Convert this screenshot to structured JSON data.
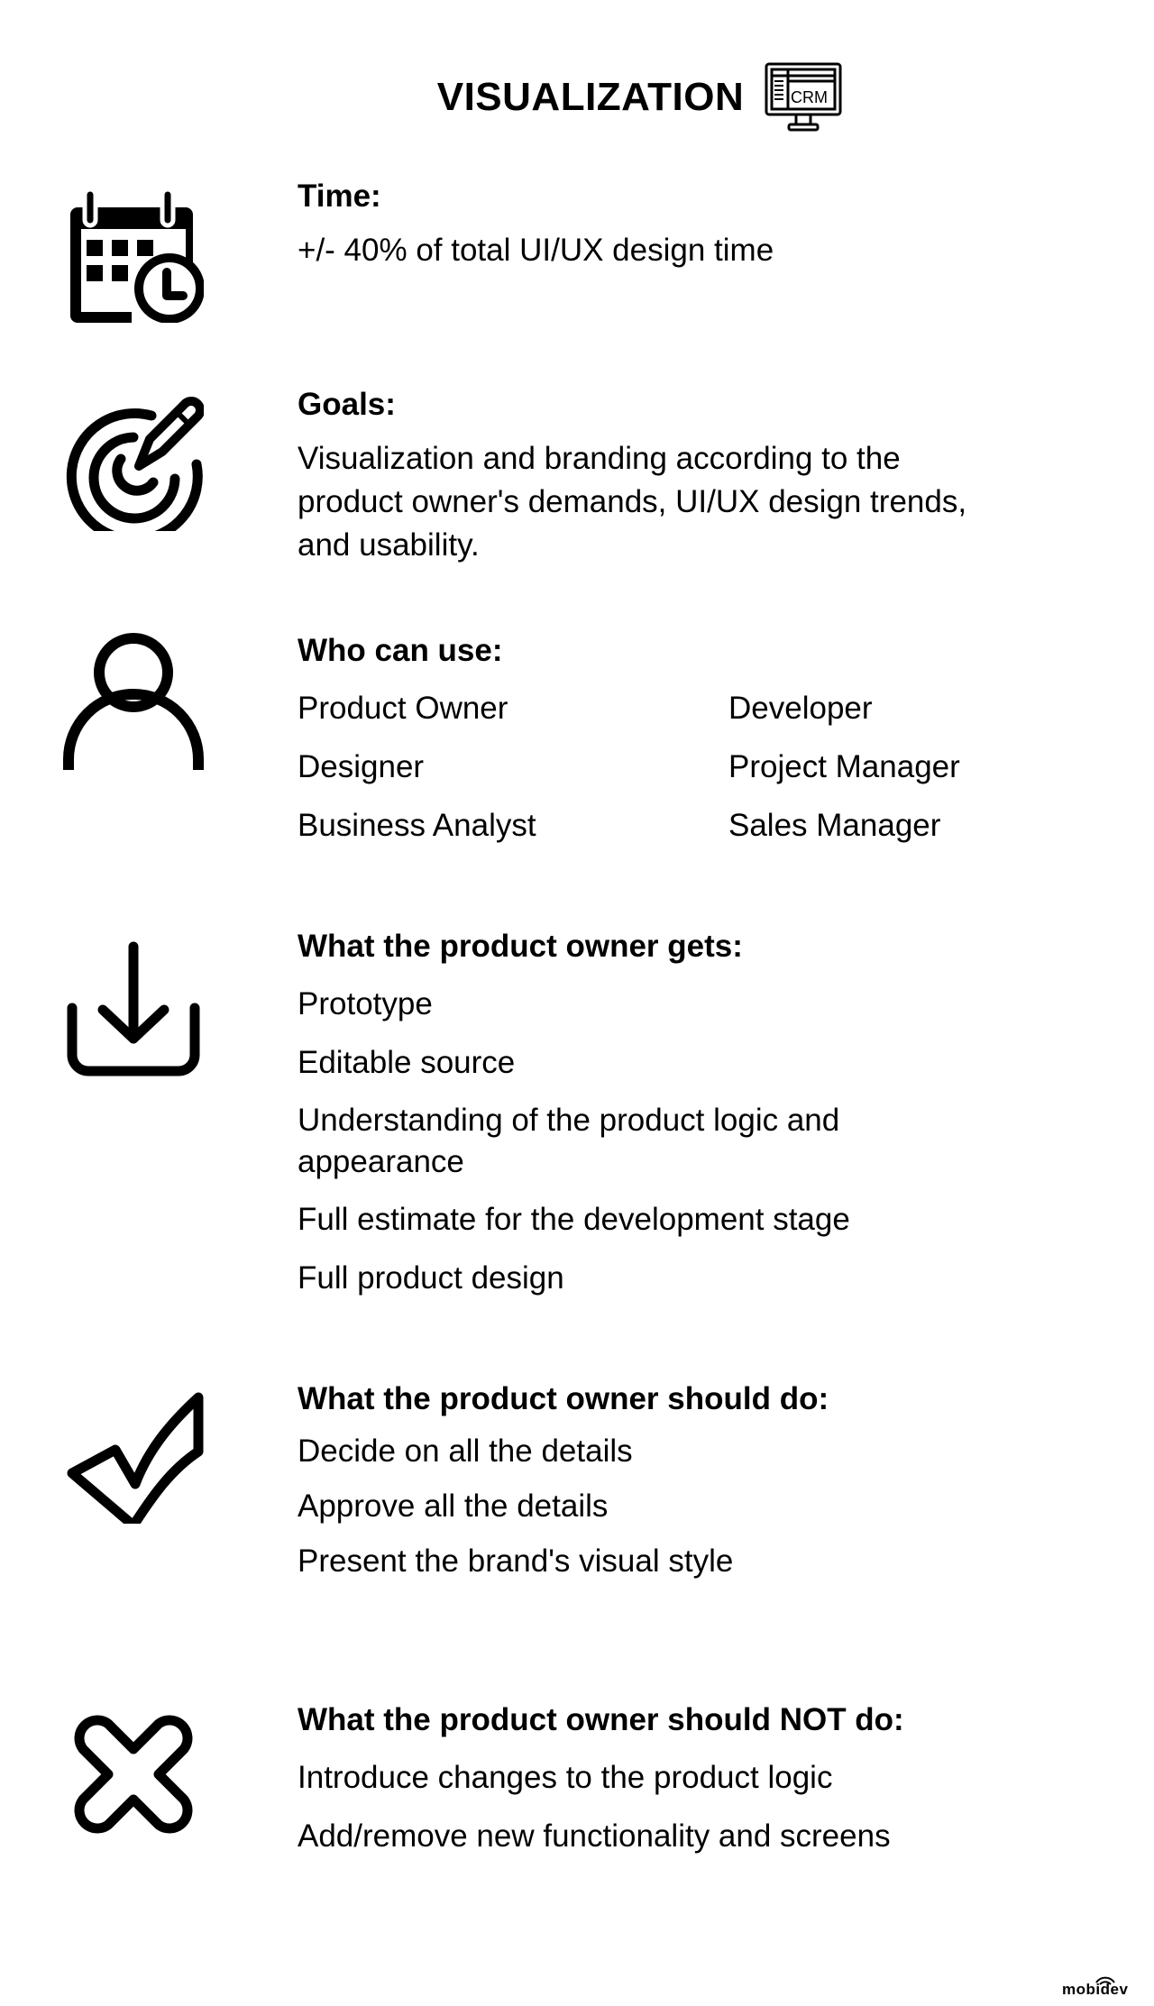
{
  "header": {
    "title": "VISUALIZATION",
    "icon": "crm-monitor-icon",
    "icon_label": "CRM"
  },
  "sections": {
    "time": {
      "icon": "calendar-clock-icon",
      "heading": "Time:",
      "text": "+/- 40% of total UI/UX design time"
    },
    "goals": {
      "icon": "target-pencil-icon",
      "heading": "Goals:",
      "text": "Visualization and branding according to the product owner's demands, UI/UX design trends, and usability."
    },
    "who_can_use": {
      "icon": "user-icon",
      "heading": "Who can use:",
      "items": [
        "Product Owner",
        "Developer",
        "Designer",
        "Project Manager",
        "Business Analyst",
        "Sales Manager"
      ]
    },
    "gets": {
      "icon": "download-icon",
      "heading": "What the product owner gets:",
      "items": [
        "Prototype",
        "Editable source",
        "Understanding of the product logic and appearance",
        "Full estimate for the development stage",
        "Full product design"
      ]
    },
    "should_do": {
      "icon": "checkmark-icon",
      "heading": "What the product owner should do:",
      "items": [
        "Decide on all the details",
        "Approve all the details",
        "Present the brand's visual style"
      ]
    },
    "should_not_do": {
      "icon": "cross-icon",
      "heading": "What the product owner should NOT do:",
      "items": [
        "Introduce changes to the product logic",
        "Add/remove new functionality and screens"
      ]
    }
  },
  "footer": {
    "logo_text": "mobidev"
  }
}
